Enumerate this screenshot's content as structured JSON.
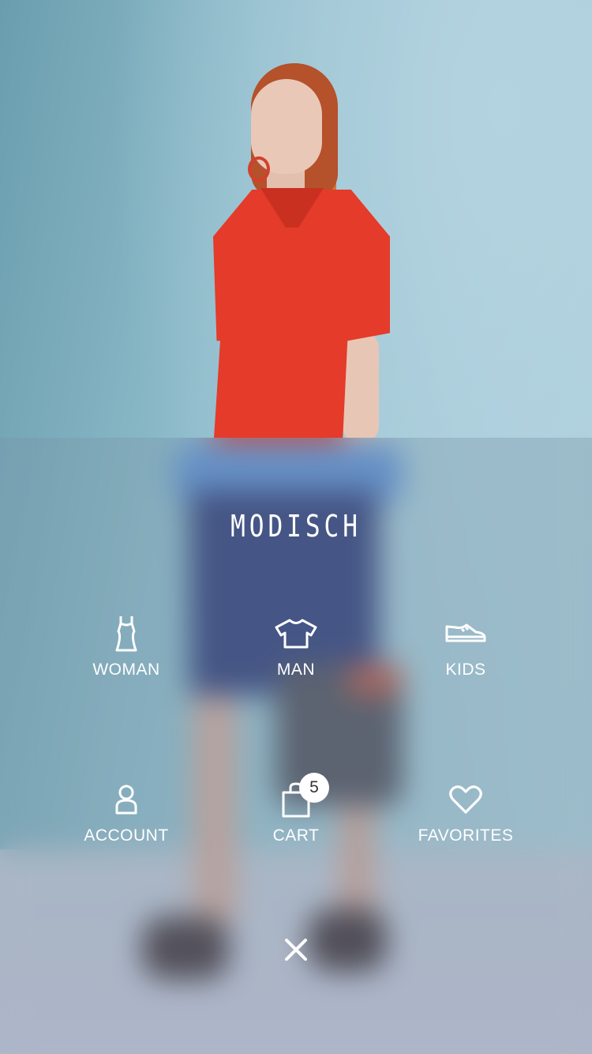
{
  "brand": "MODISCH",
  "menu": {
    "woman": {
      "label": "WOMAN",
      "icon": "dress-icon"
    },
    "man": {
      "label": "MAN",
      "icon": "tshirt-icon"
    },
    "kids": {
      "label": "KIDS",
      "icon": "sneaker-icon"
    },
    "account": {
      "label": "ACCOUNT",
      "icon": "user-icon"
    },
    "cart": {
      "label": "CART",
      "icon": "shopping-bag-icon",
      "count": "5"
    },
    "favorites": {
      "label": "FAVORITES",
      "icon": "heart-icon"
    }
  },
  "close": {
    "icon": "close-icon"
  }
}
